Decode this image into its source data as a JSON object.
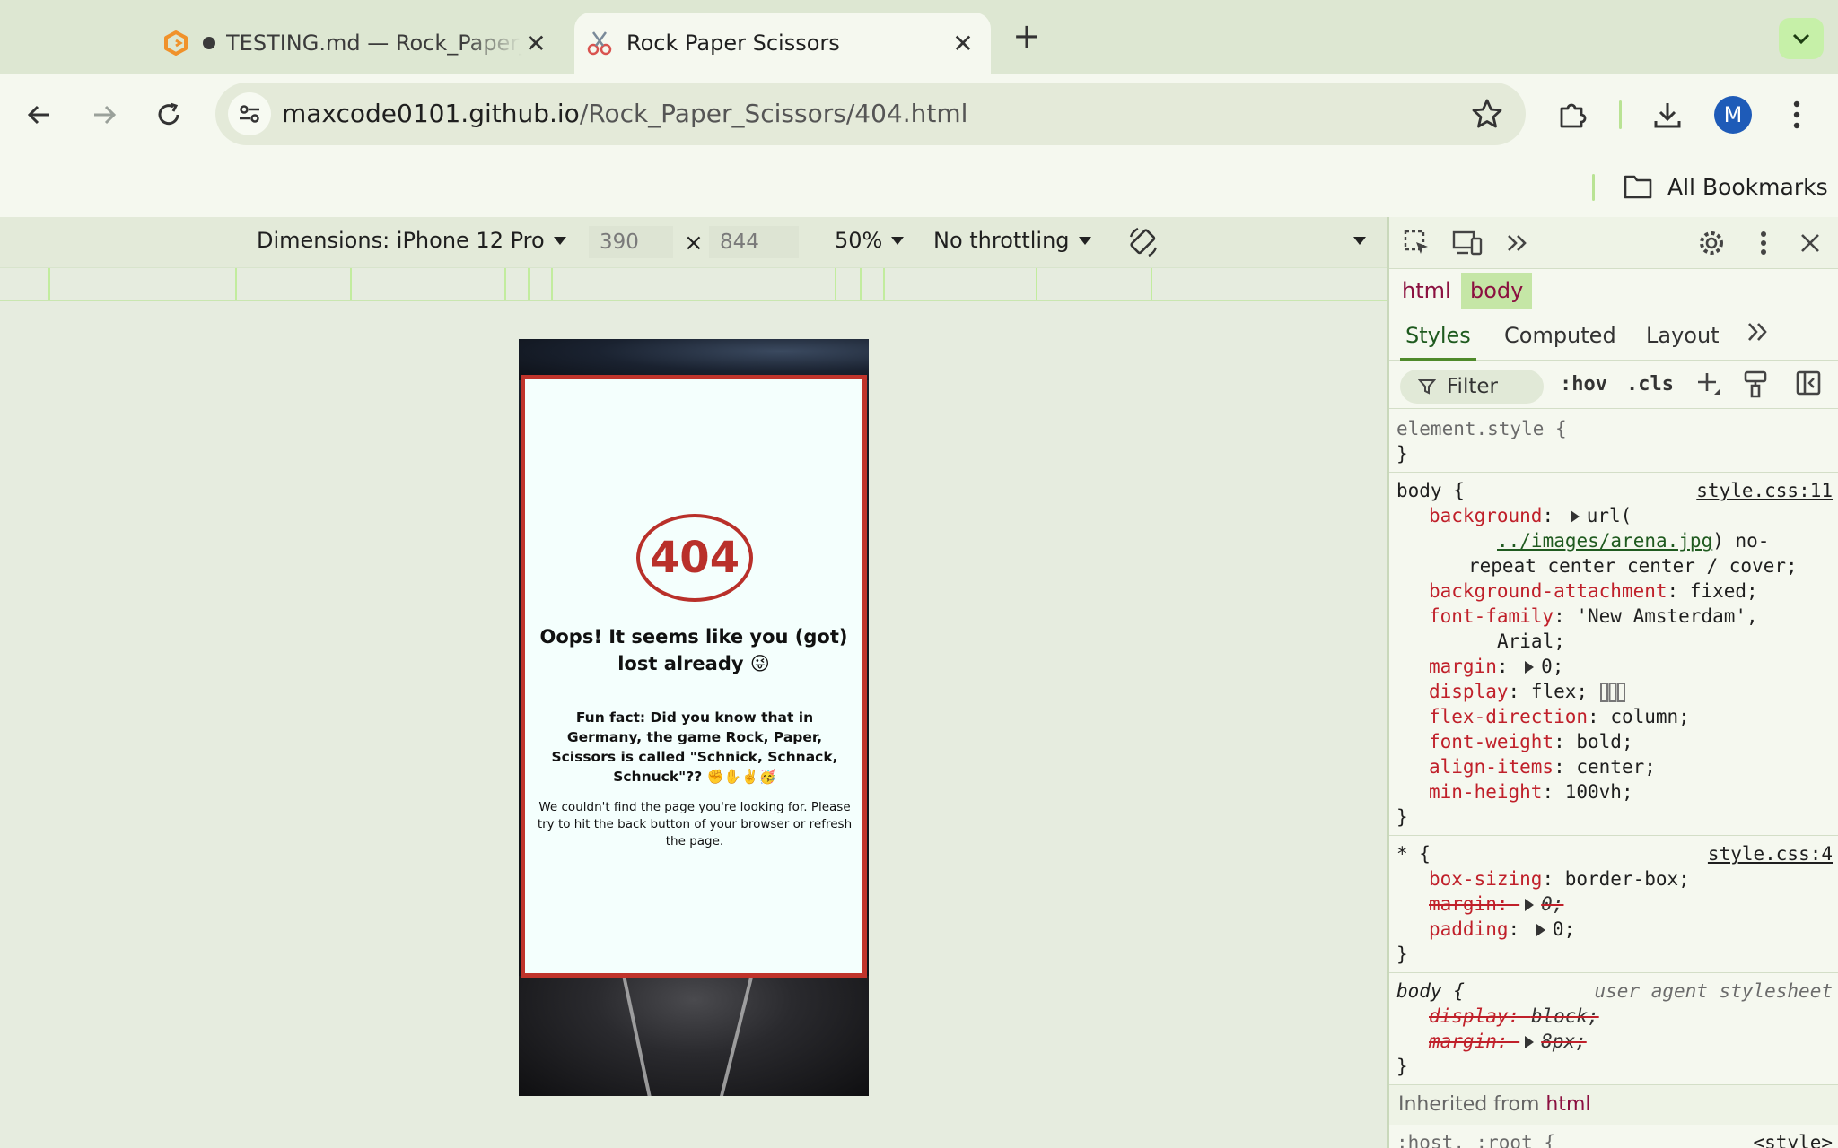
{
  "browser": {
    "tabs": [
      {
        "title": "TESTING.md — Rock_Paper_Scissors",
        "active": false,
        "unsaved_dot": true
      },
      {
        "title": "Rock Paper Scissors",
        "active": true
      }
    ],
    "url_host": "maxcode0101.github.io",
    "url_path": "/Rock_Paper_Scissors/404.html",
    "avatar_letter": "M",
    "all_bookmarks": "All Bookmarks"
  },
  "device_toolbar": {
    "dimensions": "Dimensions: iPhone 12 Pro",
    "width": "390",
    "x": "×",
    "height": "844",
    "zoom": "50%",
    "throttling": "No throttling"
  },
  "page": {
    "code": "404",
    "heading": "Oops! It seems like you (got) lost already 😜",
    "fun_fact": "Fun fact: Did you know that in Germany, the game Rock, Paper, Scissors is called \"Schnick, Schnack, Schnuck\"?? ✊✋✌️🥳",
    "message": "We couldn't find the page you're looking for. Please try to hit the back button of your browser or refresh the page."
  },
  "devtools": {
    "breadcrumbs": [
      "html",
      "body"
    ],
    "tabs": [
      "Styles",
      "Computed",
      "Layout"
    ],
    "filter_placeholder": "Filter",
    "hov": ":hov",
    "cls": ".cls",
    "element_style": "element.style {",
    "close_brace": "}",
    "rule_body_1": {
      "selector": "body {",
      "source": "style.css:11",
      "background_prop": "background",
      "background_url_open": "url(",
      "background_url": "../images/arena.jpg",
      "background_url_rest": ") no-",
      "background_cont": "repeat center center / cover;",
      "bg_attach_prop": "background-attachment",
      "bg_attach_val": "fixed;",
      "font_family_prop": "font-family",
      "font_family_val": "'New Amsterdam',",
      "font_family_cont": "Arial;",
      "margin_prop": "margin",
      "margin_val": "0;",
      "display_prop": "display",
      "display_val": "flex;",
      "flexdir_prop": "flex-direction",
      "flexdir_val": "column;",
      "fontweight_prop": "font-weight",
      "fontweight_val": "bold;",
      "align_prop": "align-items",
      "align_val": "center;",
      "minheight_prop": "min-height",
      "minheight_val": "100vh;"
    },
    "rule_star": {
      "selector": "* {",
      "source": "style.css:4",
      "boxsizing_prop": "box-sizing",
      "boxsizing_val": "border-box;",
      "margin_prop": "margin",
      "margin_val": "0;",
      "padding_prop": "padding",
      "padding_val": "0;"
    },
    "rule_ua": {
      "selector": "body {",
      "source": "user agent stylesheet",
      "display_prop": "display",
      "display_val": "block;",
      "margin_prop": "margin",
      "margin_val": "8px;"
    },
    "inherited_label": "Inherited from",
    "inherited_tag": "html",
    "next_rule": ":host, :root {",
    "next_source": "<style>"
  },
  "colors": {
    "accent_green": "#c5e6a6",
    "card_border": "#c0342b",
    "badge_red": "#b9302a"
  }
}
